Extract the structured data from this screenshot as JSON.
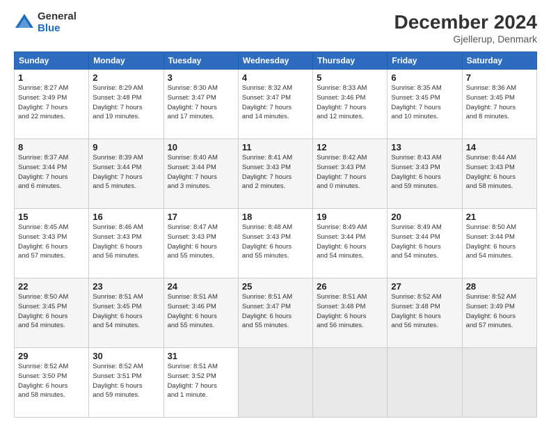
{
  "logo": {
    "general": "General",
    "blue": "Blue"
  },
  "header": {
    "title": "December 2024",
    "subtitle": "Gjellerup, Denmark"
  },
  "weekdays": [
    "Sunday",
    "Monday",
    "Tuesday",
    "Wednesday",
    "Thursday",
    "Friday",
    "Saturday"
  ],
  "weeks": [
    [
      {
        "day": "1",
        "info": "Sunrise: 8:27 AM\nSunset: 3:49 PM\nDaylight: 7 hours\nand 22 minutes."
      },
      {
        "day": "2",
        "info": "Sunrise: 8:29 AM\nSunset: 3:48 PM\nDaylight: 7 hours\nand 19 minutes."
      },
      {
        "day": "3",
        "info": "Sunrise: 8:30 AM\nSunset: 3:47 PM\nDaylight: 7 hours\nand 17 minutes."
      },
      {
        "day": "4",
        "info": "Sunrise: 8:32 AM\nSunset: 3:47 PM\nDaylight: 7 hours\nand 14 minutes."
      },
      {
        "day": "5",
        "info": "Sunrise: 8:33 AM\nSunset: 3:46 PM\nDaylight: 7 hours\nand 12 minutes."
      },
      {
        "day": "6",
        "info": "Sunrise: 8:35 AM\nSunset: 3:45 PM\nDaylight: 7 hours\nand 10 minutes."
      },
      {
        "day": "7",
        "info": "Sunrise: 8:36 AM\nSunset: 3:45 PM\nDaylight: 7 hours\nand 8 minutes."
      }
    ],
    [
      {
        "day": "8",
        "info": "Sunrise: 8:37 AM\nSunset: 3:44 PM\nDaylight: 7 hours\nand 6 minutes."
      },
      {
        "day": "9",
        "info": "Sunrise: 8:39 AM\nSunset: 3:44 PM\nDaylight: 7 hours\nand 5 minutes."
      },
      {
        "day": "10",
        "info": "Sunrise: 8:40 AM\nSunset: 3:44 PM\nDaylight: 7 hours\nand 3 minutes."
      },
      {
        "day": "11",
        "info": "Sunrise: 8:41 AM\nSunset: 3:43 PM\nDaylight: 7 hours\nand 2 minutes."
      },
      {
        "day": "12",
        "info": "Sunrise: 8:42 AM\nSunset: 3:43 PM\nDaylight: 7 hours\nand 0 minutes."
      },
      {
        "day": "13",
        "info": "Sunrise: 8:43 AM\nSunset: 3:43 PM\nDaylight: 6 hours\nand 59 minutes."
      },
      {
        "day": "14",
        "info": "Sunrise: 8:44 AM\nSunset: 3:43 PM\nDaylight: 6 hours\nand 58 minutes."
      }
    ],
    [
      {
        "day": "15",
        "info": "Sunrise: 8:45 AM\nSunset: 3:43 PM\nDaylight: 6 hours\nand 57 minutes."
      },
      {
        "day": "16",
        "info": "Sunrise: 8:46 AM\nSunset: 3:43 PM\nDaylight: 6 hours\nand 56 minutes."
      },
      {
        "day": "17",
        "info": "Sunrise: 8:47 AM\nSunset: 3:43 PM\nDaylight: 6 hours\nand 55 minutes."
      },
      {
        "day": "18",
        "info": "Sunrise: 8:48 AM\nSunset: 3:43 PM\nDaylight: 6 hours\nand 55 minutes."
      },
      {
        "day": "19",
        "info": "Sunrise: 8:49 AM\nSunset: 3:44 PM\nDaylight: 6 hours\nand 54 minutes."
      },
      {
        "day": "20",
        "info": "Sunrise: 8:49 AM\nSunset: 3:44 PM\nDaylight: 6 hours\nand 54 minutes."
      },
      {
        "day": "21",
        "info": "Sunrise: 8:50 AM\nSunset: 3:44 PM\nDaylight: 6 hours\nand 54 minutes."
      }
    ],
    [
      {
        "day": "22",
        "info": "Sunrise: 8:50 AM\nSunset: 3:45 PM\nDaylight: 6 hours\nand 54 minutes."
      },
      {
        "day": "23",
        "info": "Sunrise: 8:51 AM\nSunset: 3:45 PM\nDaylight: 6 hours\nand 54 minutes."
      },
      {
        "day": "24",
        "info": "Sunrise: 8:51 AM\nSunset: 3:46 PM\nDaylight: 6 hours\nand 55 minutes."
      },
      {
        "day": "25",
        "info": "Sunrise: 8:51 AM\nSunset: 3:47 PM\nDaylight: 6 hours\nand 55 minutes."
      },
      {
        "day": "26",
        "info": "Sunrise: 8:51 AM\nSunset: 3:48 PM\nDaylight: 6 hours\nand 56 minutes."
      },
      {
        "day": "27",
        "info": "Sunrise: 8:52 AM\nSunset: 3:48 PM\nDaylight: 6 hours\nand 56 minutes."
      },
      {
        "day": "28",
        "info": "Sunrise: 8:52 AM\nSunset: 3:49 PM\nDaylight: 6 hours\nand 57 minutes."
      }
    ],
    [
      {
        "day": "29",
        "info": "Sunrise: 8:52 AM\nSunset: 3:50 PM\nDaylight: 6 hours\nand 58 minutes."
      },
      {
        "day": "30",
        "info": "Sunrise: 8:52 AM\nSunset: 3:51 PM\nDaylight: 6 hours\nand 59 minutes."
      },
      {
        "day": "31",
        "info": "Sunrise: 8:51 AM\nSunset: 3:52 PM\nDaylight: 7 hours\nand 1 minute."
      },
      {
        "day": "",
        "info": ""
      },
      {
        "day": "",
        "info": ""
      },
      {
        "day": "",
        "info": ""
      },
      {
        "day": "",
        "info": ""
      }
    ]
  ]
}
